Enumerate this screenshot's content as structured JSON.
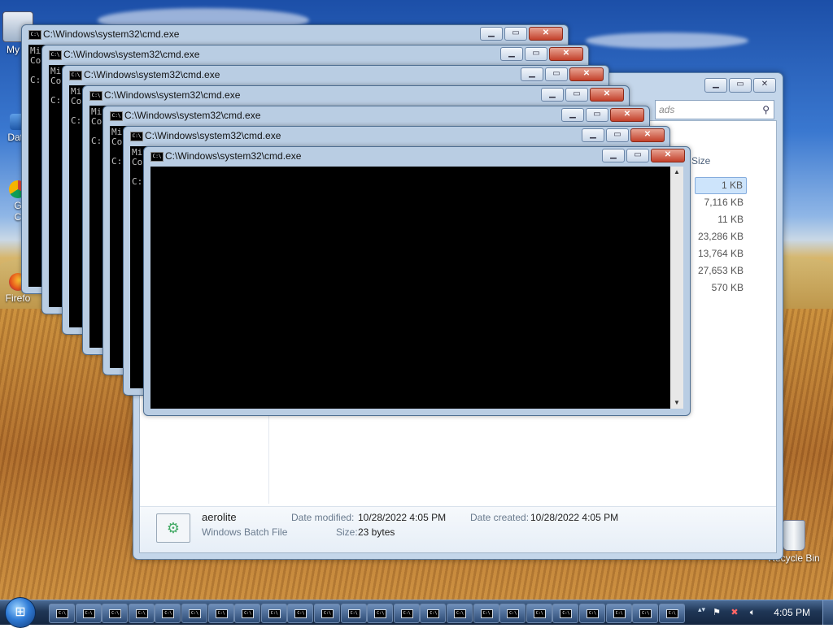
{
  "desktop": {
    "icons": [
      {
        "label": "My C",
        "icon": "computer-icon"
      },
      {
        "label": "Data",
        "icon": "folder-icon"
      },
      {
        "label": "G\nC",
        "icon": "chrome-icon"
      },
      {
        "label": "Firefo",
        "icon": "firefox-icon"
      },
      {
        "label": "Recycle Bin",
        "icon": "recycle-bin-icon"
      }
    ]
  },
  "explorer": {
    "search_placeholder": "ads",
    "size_header": "Size",
    "sizes": [
      "1 KB",
      "7,116 KB",
      "11 KB",
      "23,286 KB",
      "13,764 KB",
      "27,653 KB",
      "570 KB"
    ],
    "details": {
      "name": "aerolite",
      "type": "Windows Batch File",
      "date_modified_label": "Date modified:",
      "date_modified": "10/28/2022 4:05 PM",
      "date_created_label": "Date created:",
      "date_created": "10/28/2022 4:05 PM",
      "size_label": "Size:",
      "size": "23 bytes"
    }
  },
  "cmd_windows": {
    "title": "C:\\Windows\\system32\\cmd.exe",
    "console_text": "Mi\nCo\n\nC:",
    "count": 7
  },
  "taskbar": {
    "start_icon": "windows-orb-icon",
    "clock": "4:05 PM",
    "tray_icons": [
      "network-icon",
      "action-center-icon",
      "volume-icon"
    ]
  }
}
